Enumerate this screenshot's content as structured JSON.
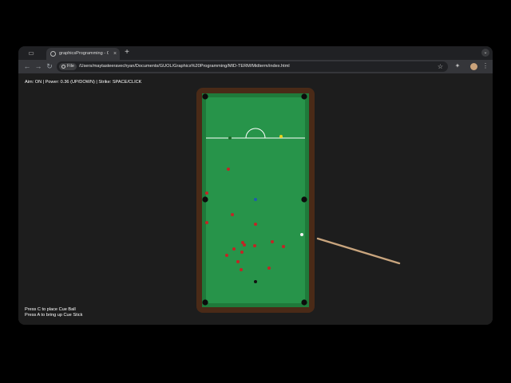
{
  "browser": {
    "tab_title": "graphicsProgramming - Cou",
    "tab_close": "×",
    "new_tab": "+",
    "site_label": "File",
    "url": "/Users/maytasteeravechyan/Documents/GUOL/Graphics%20Programming/MID-TERM/Midterm/index.html",
    "nav_back": "←",
    "nav_forward": "→",
    "nav_reload": "↻",
    "icons": {
      "tab_strip": "tab-strip-icon",
      "bookmark": "star-icon",
      "extensions": "puzzle-icon",
      "menu": "kebab-menu-icon"
    }
  },
  "game": {
    "hud_text": "Aim: ON | Power: 0.36 (UP/DOWN) | Strike: SPACE/CLICK",
    "help_lines": [
      "Press C to place Cue Ball",
      "Press A to bring up Cue Stick"
    ],
    "aim_on": true,
    "power": 0.36,
    "colors": {
      "cloth": "#27944a",
      "cushion": "#1f7a3a",
      "rail": "#4a2a17",
      "pocket": "#0c0c0c",
      "line": "#ffffff",
      "red": "#c22525",
      "yellow": "#e8d21c",
      "green": "#1f6d2c",
      "blue": "#1e5fa8",
      "black": "#111111",
      "cue_ball": "#f2f2f2",
      "cue_stick": "#c9a57e"
    }
  }
}
